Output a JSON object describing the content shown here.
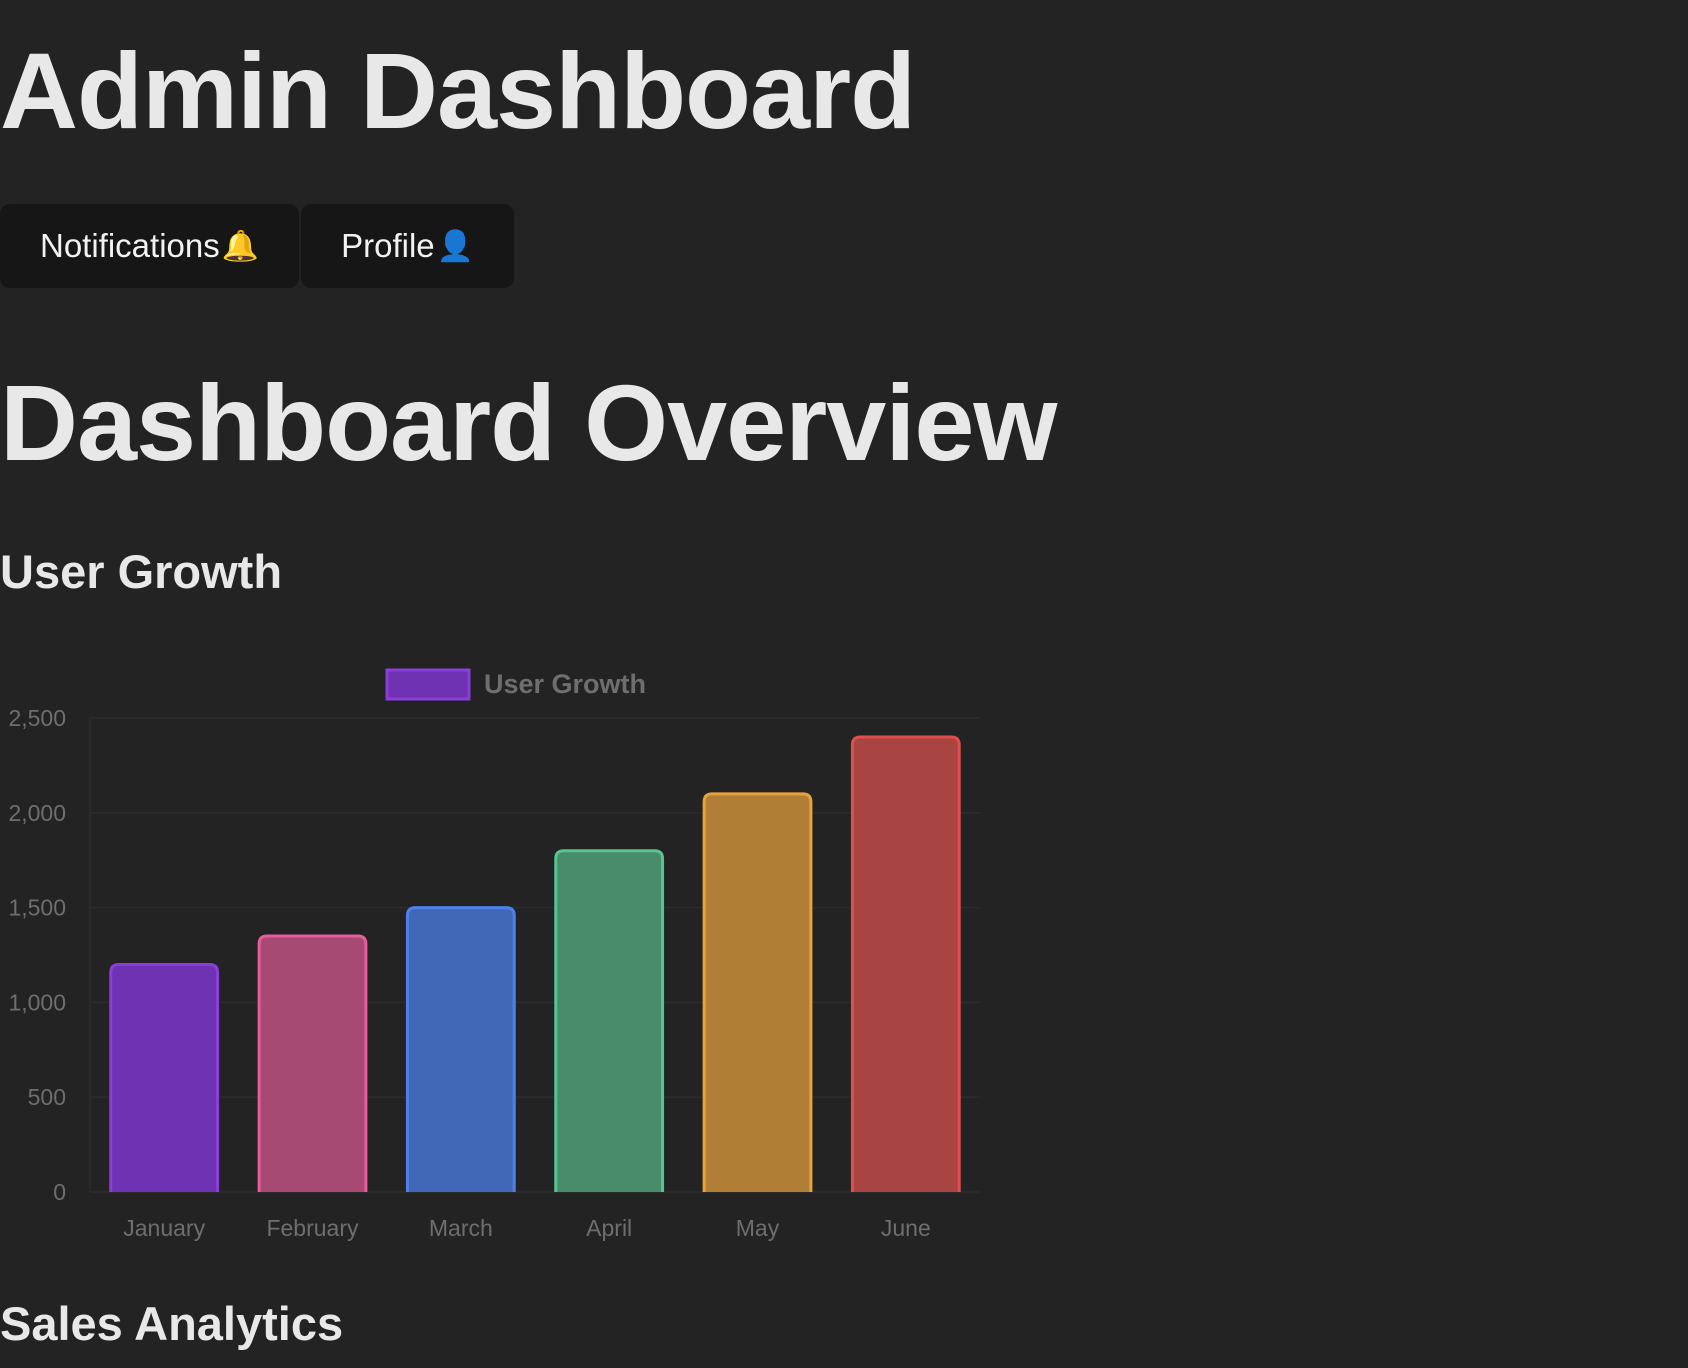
{
  "header": {
    "title": "Admin Dashboard",
    "buttons": [
      {
        "label": "Notifications",
        "icon": "bell-icon",
        "glyph": "🔔"
      },
      {
        "label": "Profile",
        "icon": "user-icon",
        "glyph": "👤"
      }
    ]
  },
  "main": {
    "title": "Dashboard Overview",
    "sections": [
      {
        "title": "User Growth"
      },
      {
        "title": "Sales Analytics"
      }
    ]
  },
  "chart_data": {
    "type": "bar",
    "categories": [
      "January",
      "February",
      "March",
      "April",
      "May",
      "June"
    ],
    "series": [
      {
        "name": "User Growth",
        "values": [
          1200,
          1350,
          1500,
          1800,
          2100,
          2400
        ]
      }
    ],
    "legend": "top-center",
    "ylim": [
      0,
      2500
    ],
    "yticks": [
      0,
      500,
      1000,
      1500,
      2000,
      2500
    ],
    "ytick_labels": [
      "0",
      "500",
      "1,000",
      "1,500",
      "2,000",
      "2,500"
    ],
    "grid": true,
    "fill_colors": [
      "#6f32b3",
      "#a64a74",
      "#4168b7",
      "#488c6c",
      "#b07e35",
      "#a84441"
    ],
    "border_colors": [
      "#8a3fdb",
      "#e65c9c",
      "#4f80ea",
      "#56c690",
      "#e8a23d",
      "#e24d4d"
    ],
    "legend_fill": "#6f32b3",
    "legend_border": "#8a3fdb"
  }
}
